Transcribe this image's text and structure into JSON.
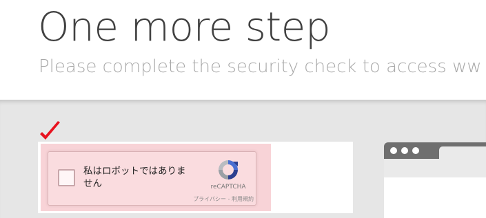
{
  "header": {
    "title": "One more step",
    "subtitle": "Please complete the security check to access ww"
  },
  "captcha": {
    "checkbox_label": "私はロボットではありません",
    "brand": "reCAPTCHA",
    "links": "プライバシー - 利用規約",
    "checked": false
  },
  "colors": {
    "accent_check": "#e8131f",
    "highlight": "#f8d3d7",
    "band": "#e6e6e6"
  }
}
